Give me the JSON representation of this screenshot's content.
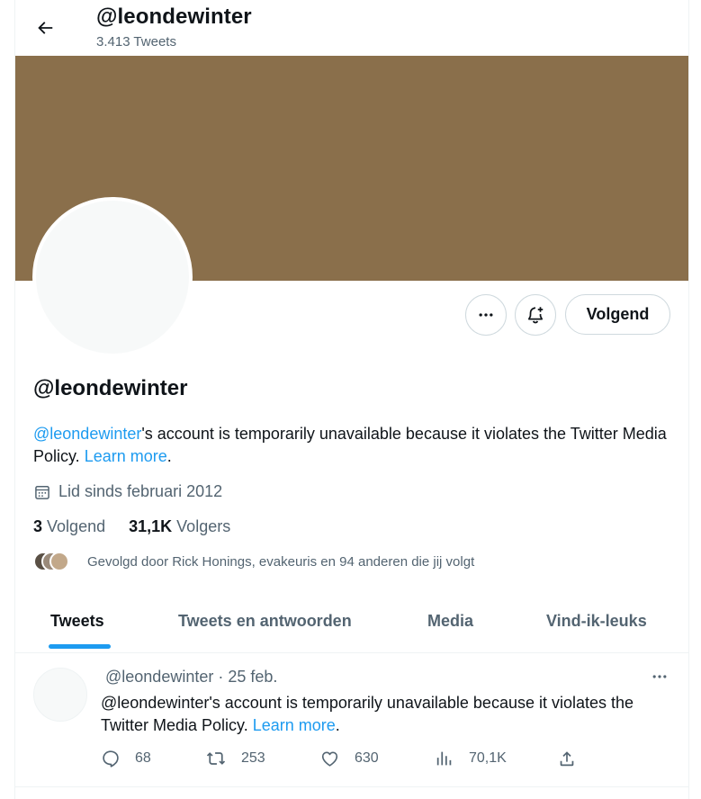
{
  "header": {
    "handle": "@leondewinter",
    "tweet_count": "3.413 Tweets"
  },
  "colors": {
    "banner": "#8a6f4b",
    "accent": "#1d9bf0",
    "avatar_ring": [
      "#5a5045",
      "#9a8a7a",
      "#c2a88a"
    ]
  },
  "profile": {
    "name": "@leondewinter",
    "follow_button_label": "Volgend",
    "bio_handle": "@leondewinter",
    "bio_text": "'s account is temporarily unavailable because it violates the Twitter Media Policy. ",
    "bio_link": "Learn more",
    "bio_end": ".",
    "joined": "Lid sinds februari 2012",
    "following_count": "3",
    "following_label": "Volgend",
    "followers_count": "31,1K",
    "followers_label": "Volgers",
    "followed_by": "Gevolgd door Rick Honings, evakeuris en 94 anderen die jij volgt"
  },
  "tabs": [
    {
      "label": "Tweets"
    },
    {
      "label": "Tweets en antwoorden"
    },
    {
      "label": "Media"
    },
    {
      "label": "Vind-ik-leuks"
    }
  ],
  "tweet": {
    "handle": "@leondewinter",
    "separator": " · ",
    "date": "25 feb.",
    "text": "@leondewinter's account is temporarily unavailable because it violates the Twitter Media Policy. ",
    "link": "Learn more",
    "end": ".",
    "replies": "68",
    "retweets": "253",
    "likes": "630",
    "views": "70,1K"
  },
  "icons": {
    "back": "arrow-left-icon",
    "more": "more-dots-icon",
    "notify": "bell-plus-icon",
    "calendar": "calendar-icon",
    "reply": "reply-icon",
    "retweet": "retweet-icon",
    "like": "heart-icon",
    "views": "views-chart-icon",
    "share": "share-icon"
  }
}
